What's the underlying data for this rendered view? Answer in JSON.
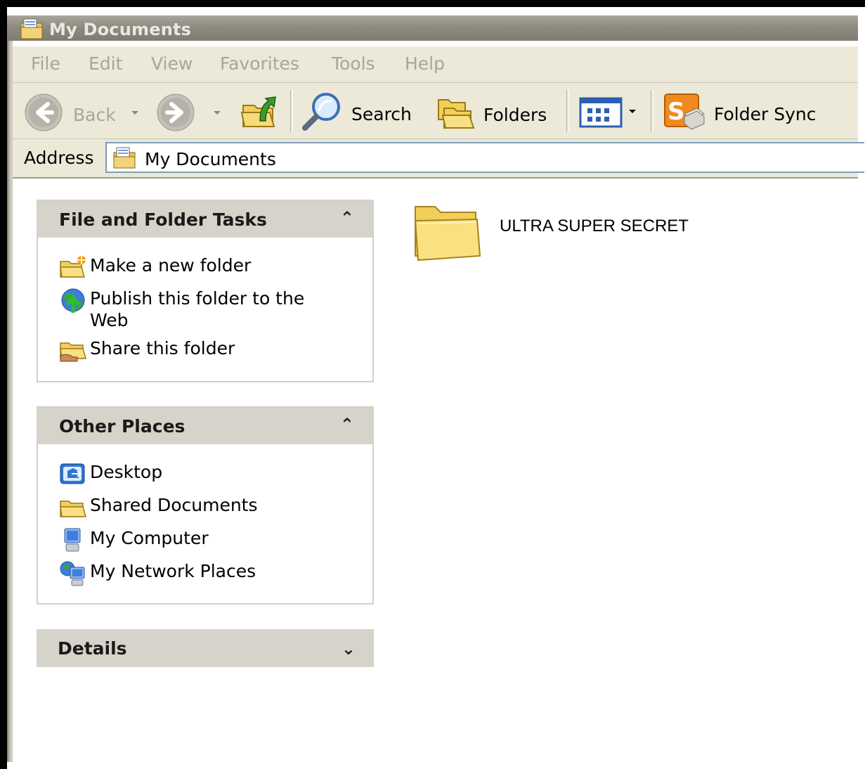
{
  "window": {
    "title": "My Documents"
  },
  "menu": [
    "File",
    "Edit",
    "View",
    "Favorites",
    "Tools",
    "Help"
  ],
  "toolbar": {
    "back_label": "Back",
    "search_label": "Search",
    "folders_label": "Folders",
    "foldersync_label": "Folder Sync"
  },
  "address": {
    "label": "Address",
    "value": "My Documents"
  },
  "sidebar": {
    "file_tasks": {
      "title": "File and Folder Tasks",
      "items": [
        "Make a new folder",
        "Publish this folder to the Web",
        "Share this folder"
      ]
    },
    "other_places": {
      "title": "Other Places",
      "items": [
        "Desktop",
        "Shared Documents",
        "My Computer",
        "My Network Places"
      ]
    },
    "details": {
      "title": "Details"
    }
  },
  "content": {
    "items": [
      {
        "name": "ULTRA SUPER SECRET",
        "type": "folder"
      }
    ]
  },
  "icons": {
    "title": "my-documents-icon",
    "back": "back-arrow-icon",
    "forward": "forward-arrow-icon",
    "up": "up-folder-icon",
    "search": "search-magnifier-icon",
    "folders": "folders-icon",
    "views": "views-icon",
    "foldersync": "folder-sync-icon"
  }
}
